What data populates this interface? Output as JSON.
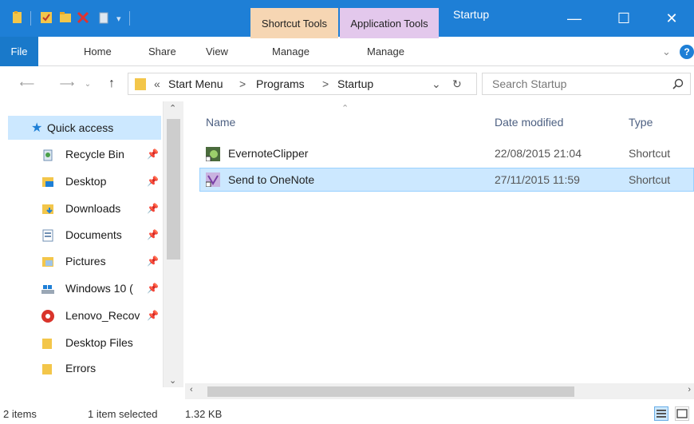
{
  "window": {
    "title": "Startup",
    "contextual_tabs": [
      "Shortcut Tools",
      "Application Tools"
    ],
    "minimize": "—",
    "maximize": "☐",
    "close": "✕"
  },
  "ribbon": {
    "tabs": [
      "File",
      "Home",
      "Share",
      "View",
      "Manage",
      "Manage"
    ],
    "collapse_glyph": "⌄",
    "help_glyph": "?"
  },
  "address": {
    "breadcrumb_prefix": "«",
    "parts": [
      "Start Menu",
      "Programs",
      "Startup"
    ],
    "separator": ">",
    "search_placeholder": "Search Startup"
  },
  "nav": {
    "items": [
      {
        "label": "Quick access",
        "icon": "star-icon",
        "pinned": false
      },
      {
        "label": "Recycle Bin",
        "icon": "recycle-bin-icon",
        "pinned": true
      },
      {
        "label": "Desktop",
        "icon": "desktop-folder-icon",
        "pinned": true
      },
      {
        "label": "Downloads",
        "icon": "downloads-folder-icon",
        "pinned": true
      },
      {
        "label": "Documents",
        "icon": "documents-folder-icon",
        "pinned": true
      },
      {
        "label": "Pictures",
        "icon": "pictures-folder-icon",
        "pinned": true
      },
      {
        "label": "Windows 10 (",
        "icon": "drive-icon",
        "pinned": true
      },
      {
        "label": "Lenovo_Recov",
        "icon": "lenovo-recovery-icon",
        "pinned": true
      },
      {
        "label": "Desktop Files",
        "icon": "folder-icon",
        "pinned": false
      },
      {
        "label": "Errors",
        "icon": "folder-icon",
        "pinned": false
      }
    ]
  },
  "content": {
    "columns": [
      "Name",
      "Date modified",
      "Type"
    ],
    "files": [
      {
        "name": "EvernoteClipper",
        "date": "22/08/2015 21:04",
        "type": "Shortcut",
        "icon": "evernote-shortcut-icon",
        "selected": false
      },
      {
        "name": "Send to OneNote",
        "date": "27/11/2015 11:59",
        "type": "Shortcut",
        "icon": "onenote-shortcut-icon",
        "selected": true
      }
    ]
  },
  "status": {
    "item_count": "2 items",
    "selection": "1 item selected",
    "size": "1.32 KB"
  },
  "colors": {
    "titlebar": "#1e7fd6",
    "shortcut_tools": "#f6d6b3",
    "application_tools": "#e3c8ec",
    "selection": "#cce8ff"
  }
}
